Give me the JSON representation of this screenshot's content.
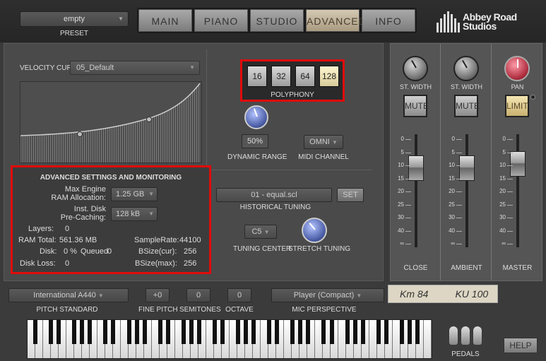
{
  "preset": {
    "value": "empty",
    "label": "PRESET"
  },
  "tabs": [
    {
      "label": "MAIN"
    },
    {
      "label": "PIANO"
    },
    {
      "label": "STUDIO"
    },
    {
      "label": "ADVANCED"
    },
    {
      "label": "INFO"
    }
  ],
  "logo": {
    "line1": "Abbey Road",
    "line2": "Studios"
  },
  "velocity": {
    "label": "VELOCITY CURVE",
    "value": "05_Default"
  },
  "polyphony": {
    "label": "POLYPHONY",
    "options": [
      "16",
      "32",
      "64",
      "128"
    ],
    "selected": "128"
  },
  "dynamic_range": {
    "value": "50%",
    "label": "DYNAMIC RANGE"
  },
  "midi_channel": {
    "value": "OMNI",
    "label": "MIDI CHANNEL"
  },
  "advanced": {
    "title": "ADVANCED SETTINGS AND MONITORING",
    "ram_label_1": "Max Engine",
    "ram_label_2": "RAM Allocation:",
    "ram_value": "1.25 GB",
    "disk_label_1": "Inst. Disk",
    "disk_label_2": "Pre-Caching:",
    "disk_value": "128 kB",
    "layers_label": "Layers:",
    "layers_value": "0",
    "ram_total_label": "RAM Total:",
    "ram_total_value": "561.36 MB",
    "samplerate_label": "SampleRate:",
    "samplerate_value": "44100",
    "disk_label": "Disk:",
    "disk_value_pct": "0 %",
    "queued_label": "Queued",
    "queued_value": "0",
    "bsize_cur_label": "BSize(cur):",
    "bsize_cur_value": "256",
    "disk_loss_label": "Disk Loss:",
    "disk_loss_value": "0",
    "bsize_max_label": "BSize(max):",
    "bsize_max_value": "256"
  },
  "tuning": {
    "file": "01 - equal.scl",
    "set_label": "SET",
    "label": "HISTORICAL TUNING",
    "center_value": "C5",
    "center_label": "TUNING CENTER",
    "stretch_label": "STRETCH TUNING"
  },
  "mixer": {
    "channels": [
      {
        "knob_label": "ST. WIDTH",
        "button": "MUTE",
        "name": "CLOSE"
      },
      {
        "knob_label": "ST. WIDTH",
        "button": "MUTE",
        "name": "AMBIENT"
      },
      {
        "knob_label": "PAN",
        "button": "LIMIT",
        "name": "MASTER"
      }
    ],
    "scale": [
      "0",
      "5",
      "10",
      "15",
      "20",
      "25",
      "30",
      "40",
      "∞"
    ]
  },
  "bottom": {
    "pitch_standard": {
      "value": "International  A440",
      "label": "PITCH STANDARD"
    },
    "fine_pitch": {
      "value": "+0",
      "label": "FINE PITCH"
    },
    "semitones": {
      "value": "0",
      "label": "SEMITONES"
    },
    "octave": {
      "value": "0",
      "label": "OCTAVE"
    },
    "mic_perspective": {
      "value": "Player (Compact)",
      "label": "MIC PERSPECTIVE"
    },
    "mics": [
      "Km 84",
      "KU 100"
    ],
    "pedals_label": "PEDALS",
    "help_label": "HELP"
  }
}
